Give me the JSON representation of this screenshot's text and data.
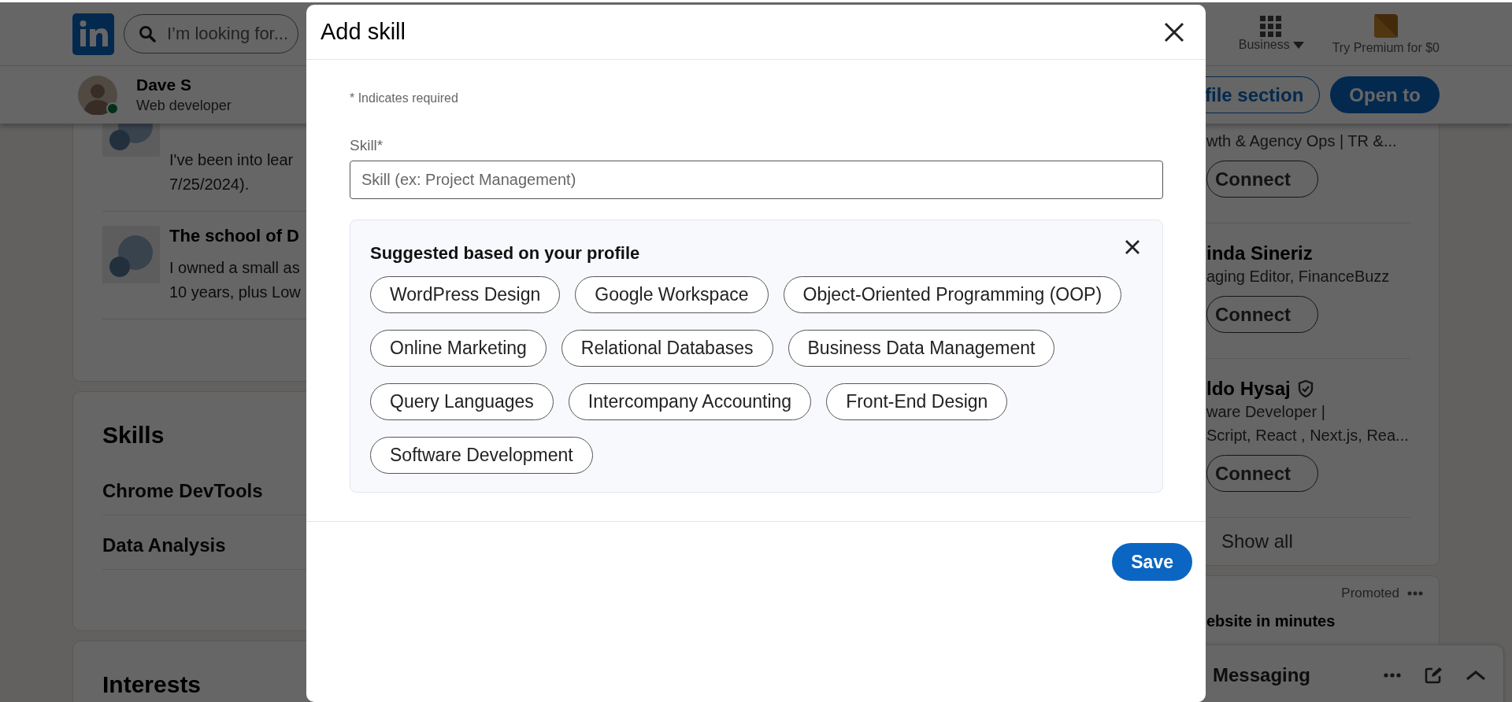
{
  "top_nav": {
    "search_placeholder": "I’m looking for...",
    "business_label": "Business",
    "premium_label": "Try Premium for $0"
  },
  "profile_bar": {
    "name": "Dave S",
    "headline": "Web developer",
    "online": true,
    "buttons": [
      {
        "label": "file section",
        "kind": "outline"
      },
      {
        "label": "Open to",
        "kind": "primary"
      }
    ]
  },
  "main": {
    "posts": [
      {
        "lines": [
          "I've been into lear",
          "7/25/2024)."
        ]
      },
      {
        "title": "The school of D",
        "lines": [
          "I owned a small as",
          "10 years, plus Low"
        ]
      }
    ],
    "skills": {
      "title": "Skills",
      "items": [
        "Chrome DevTools",
        "Data Analysis"
      ]
    },
    "interests": {
      "title": "Interests"
    }
  },
  "rail": {
    "people": [
      {
        "verified": false,
        "headline_lines": [
          "wth & Agency Ops | TR &..."
        ],
        "action": "Connect"
      },
      {
        "name": "inda Sineriz",
        "verified": false,
        "headline_lines": [
          "aging Editor, FinanceBuzz"
        ],
        "action": "Connect"
      },
      {
        "name": "ldo Hysaj",
        "verified": true,
        "headline_lines": [
          "ware Developer |",
          "Script, React , Next.js, Rea..."
        ],
        "action": "Connect"
      }
    ],
    "show_all": "Show all",
    "promoted": {
      "label": "Promoted",
      "text": "ebsite in minutes"
    }
  },
  "messaging": {
    "label": "Messaging"
  },
  "modal": {
    "title": "Add skill",
    "required_note": "* Indicates required",
    "field_label": "Skill*",
    "placeholder": "Skill (ex: Project Management)",
    "suggestions": {
      "title": "Suggested based on your profile",
      "chips": [
        "WordPress Design",
        "Google Workspace",
        "Object-Oriented Programming (OOP)",
        "Online Marketing",
        "Relational Databases",
        "Business Data Management",
        "Query Languages",
        "Intercompany Accounting",
        "Front-End Design",
        "Software Development"
      ]
    },
    "save_label": "Save"
  }
}
